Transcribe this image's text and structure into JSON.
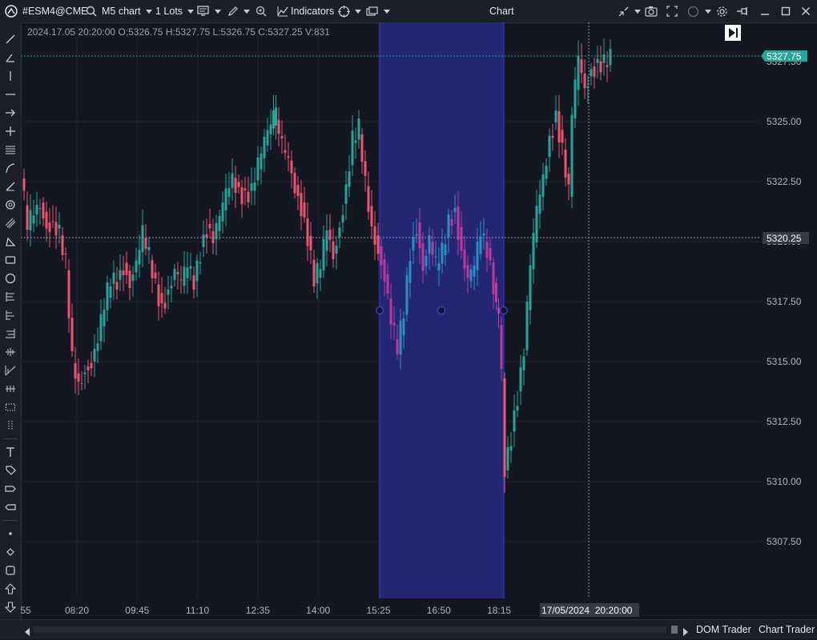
{
  "toolbar": {
    "symbol": "#ESM4@CME",
    "chart_type": "M5 chart",
    "lots": "1 Lots",
    "indicators": "Indicators",
    "window_title": "Chart"
  },
  "ohlc_info": "2024.17.05 20:20:00 O:5326.75 H:5327.75 L:5326.75 C:5327.25 V:831",
  "price_axis": {
    "ticks": [
      "5325.00",
      "5322.50",
      "5320.00",
      "5317.50",
      "5315.00",
      "5312.50",
      "5310.00",
      "5307.50"
    ],
    "current_price": "5327.75",
    "crosshair_price": "5320.25",
    "hidden_price_top": "5327.50"
  },
  "time_axis": {
    "ticks": [
      "55",
      "08:20",
      "09:45",
      "11:10",
      "12:35",
      "14:00",
      "15:25",
      "16:50",
      "18:15"
    ],
    "crosshair_time": "17/05/2024  20:20:00"
  },
  "bottom": {
    "dom_trader": "DOM Trader",
    "chart_trader": "Chart Trader"
  },
  "colors": {
    "background": "#131722",
    "bull": "#26a69a",
    "bear": "#ef5370",
    "selection_fill": "#25287a",
    "current_price_bg": "#26a69a"
  }
}
